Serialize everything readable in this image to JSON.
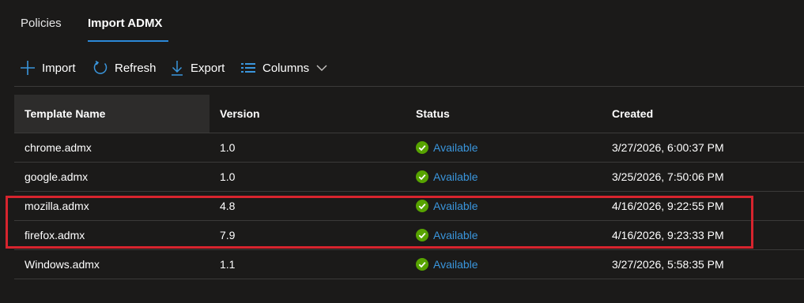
{
  "tabs": [
    {
      "label": "Policies",
      "active": false
    },
    {
      "label": "Import ADMX",
      "active": true
    }
  ],
  "toolbar": {
    "import_label": "Import",
    "refresh_label": "Refresh",
    "export_label": "Export",
    "columns_label": "Columns"
  },
  "table": {
    "columns": [
      "Template Name",
      "Version",
      "Status",
      "Created"
    ],
    "rows": [
      {
        "name": "chrome.admx",
        "version": "1.0",
        "status": "Available",
        "created": "3/27/2026, 6:00:37 PM"
      },
      {
        "name": "google.admx",
        "version": "1.0",
        "status": "Available",
        "created": "3/25/2026, 7:50:06 PM"
      },
      {
        "name": "mozilla.admx",
        "version": "4.8",
        "status": "Available",
        "created": "4/16/2026, 9:22:55 PM"
      },
      {
        "name": "firefox.admx",
        "version": "7.9",
        "status": "Available",
        "created": "4/16/2026, 9:23:33 PM"
      },
      {
        "name": "Windows.admx",
        "version": "1.1",
        "status": "Available",
        "created": "3/27/2026, 5:58:35 PM"
      }
    ]
  },
  "colors": {
    "background": "#1b1a19",
    "accent": "#2b88d8",
    "status_ok": "#57a300",
    "link": "#3a96dd",
    "highlight": "#d7242e"
  },
  "icons": {
    "import": "add-icon",
    "refresh": "refresh-icon",
    "export": "download-icon",
    "columns": "columns-icon",
    "columns_dropdown": "chevron-down-icon",
    "status": "checkmark-circle-icon"
  }
}
